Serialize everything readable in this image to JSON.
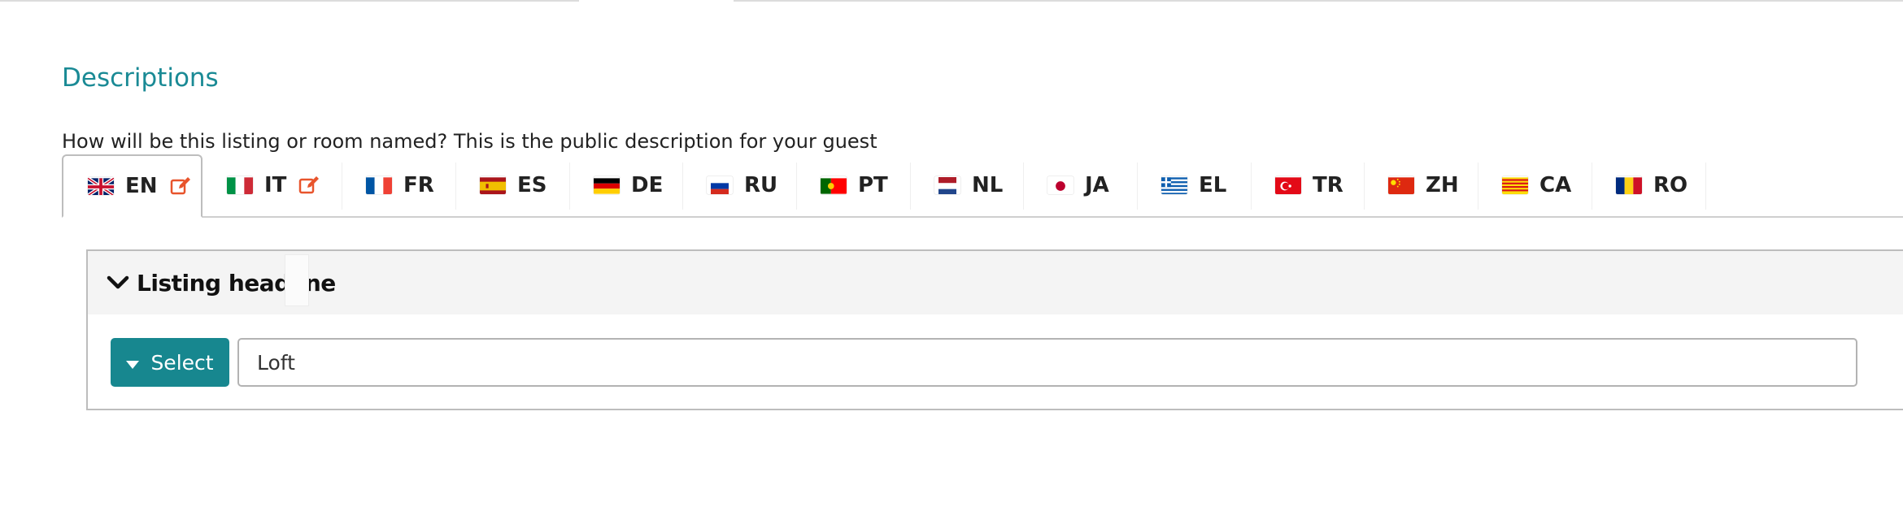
{
  "section": {
    "title": "Descriptions",
    "help_text": "How will be this listing or room named? This is the public description for your guest"
  },
  "tabs": [
    {
      "code": "EN",
      "flag": "gb-flag-icon",
      "edited": true,
      "active": true
    },
    {
      "code": "IT",
      "flag": "it-flag-icon",
      "edited": true,
      "active": false
    },
    {
      "code": "FR",
      "flag": "fr-flag-icon",
      "edited": false,
      "active": false
    },
    {
      "code": "ES",
      "flag": "es-flag-icon",
      "edited": false,
      "active": false
    },
    {
      "code": "DE",
      "flag": "de-flag-icon",
      "edited": false,
      "active": false
    },
    {
      "code": "RU",
      "flag": "ru-flag-icon",
      "edited": false,
      "active": false
    },
    {
      "code": "PT",
      "flag": "pt-flag-icon",
      "edited": false,
      "active": false
    },
    {
      "code": "NL",
      "flag": "nl-flag-icon",
      "edited": false,
      "active": false
    },
    {
      "code": "JA",
      "flag": "jp-flag-icon",
      "edited": false,
      "active": false
    },
    {
      "code": "EL",
      "flag": "gr-flag-icon",
      "edited": false,
      "active": false
    },
    {
      "code": "TR",
      "flag": "tr-flag-icon",
      "edited": false,
      "active": false
    },
    {
      "code": "ZH",
      "flag": "cn-flag-icon",
      "edited": false,
      "active": false
    },
    {
      "code": "CA",
      "flag": "catalonia-flag-icon",
      "edited": false,
      "active": false
    },
    {
      "code": "RO",
      "flag": "ro-flag-icon",
      "edited": false,
      "active": false
    }
  ],
  "panel": {
    "title": "Listing headline",
    "select_label": "Select",
    "input_value": "Loft"
  },
  "colors": {
    "accent": "#1a8a95",
    "button": "#17878f",
    "edit_icon": "#e8542c"
  }
}
